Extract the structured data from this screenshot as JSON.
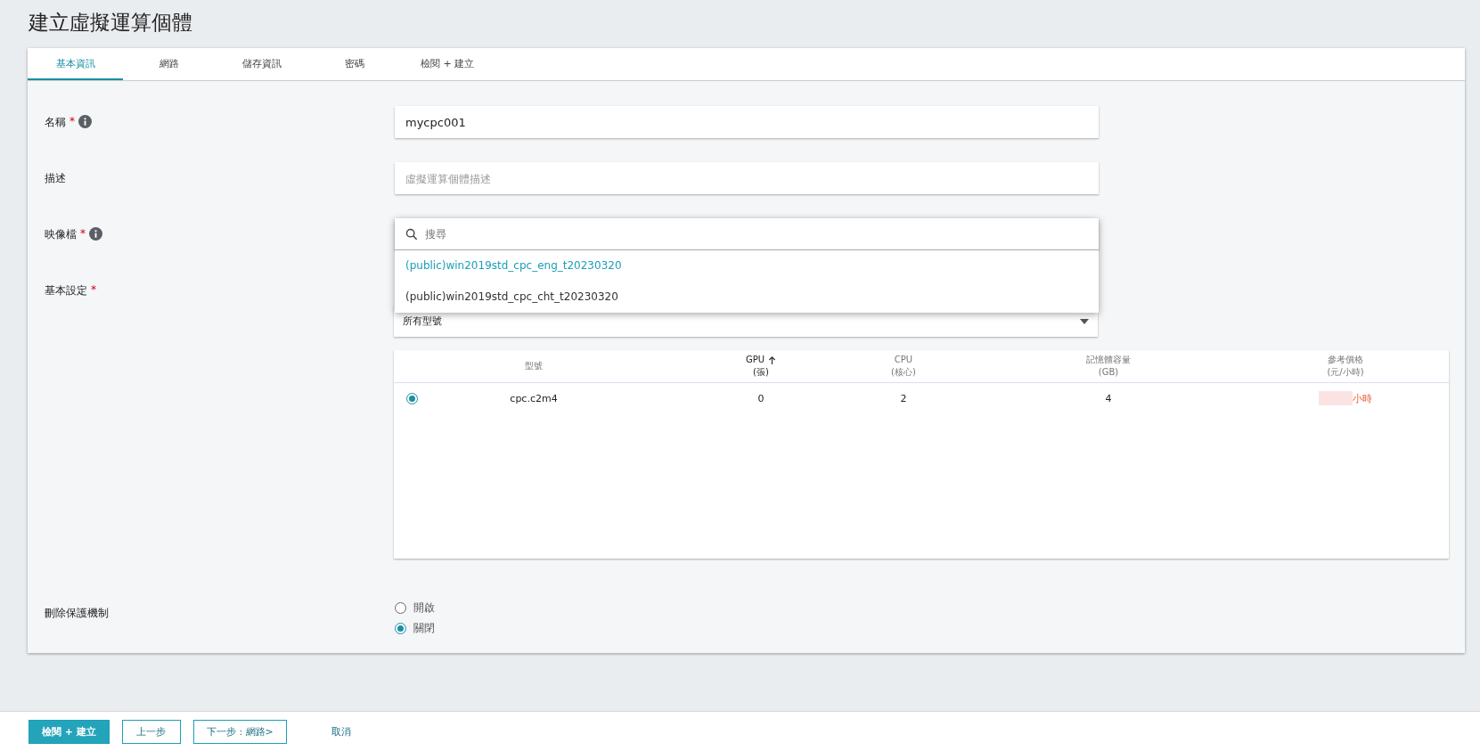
{
  "page_title": "建立虛擬運算個體",
  "tabs": [
    {
      "label": "基本資訊",
      "selected": true
    },
    {
      "label": "網路",
      "selected": false
    },
    {
      "label": "儲存資訊",
      "selected": false
    },
    {
      "label": "密碼",
      "selected": false
    },
    {
      "label": "檢閱 + 建立",
      "selected": false
    }
  ],
  "form": {
    "name": {
      "label": "名稱",
      "required_mark": "*",
      "info": true,
      "value": "mycpc001"
    },
    "description": {
      "label": "描述",
      "placeholder": "虛擬運算個體描述"
    },
    "image": {
      "label": "映像檔",
      "required_mark": "*",
      "info": true,
      "dropdown": {
        "search_placeholder": "搜尋",
        "options": [
          {
            "label": "(public)win2019std_cpc_eng_t20230320",
            "selected": true
          },
          {
            "label": "(public)win2019std_cpc_cht_t20230320",
            "selected": false
          }
        ]
      }
    },
    "basic_settings": {
      "label": "基本設定",
      "required_mark": "*",
      "select_value": "所有型號",
      "table": {
        "columns": [
          {
            "label": "型號",
            "sorted": false,
            "kind": "text"
          },
          {
            "label": "GPU",
            "unit": "(張)",
            "sorted": true,
            "kind": "number"
          },
          {
            "label": "CPU",
            "unit": "(核心)",
            "sorted": false,
            "kind": "number"
          },
          {
            "label": "記憶體容量",
            "unit": "(GB)",
            "sorted": false,
            "kind": "number"
          },
          {
            "label": "參考價格",
            "unit": "(元/小時)",
            "sorted": false,
            "kind": "price"
          }
        ],
        "rows": [
          {
            "selected": true,
            "cells": [
              "cpc.c2m4",
              "0",
              "2",
              "4",
              "小時"
            ]
          }
        ]
      }
    },
    "delete_protection": {
      "label": "刪除保護機制",
      "options": [
        {
          "label": "開啟",
          "selected": false
        },
        {
          "label": "關閉",
          "selected": true
        }
      ]
    }
  },
  "footer": {
    "buttons": [
      {
        "label": "檢閱 + 建立",
        "kind": "primary"
      },
      {
        "label": "上一步",
        "kind": "outline"
      },
      {
        "label": "下一步 : 網路>",
        "kind": "outline"
      },
      {
        "label": "取消",
        "kind": "text"
      }
    ]
  }
}
